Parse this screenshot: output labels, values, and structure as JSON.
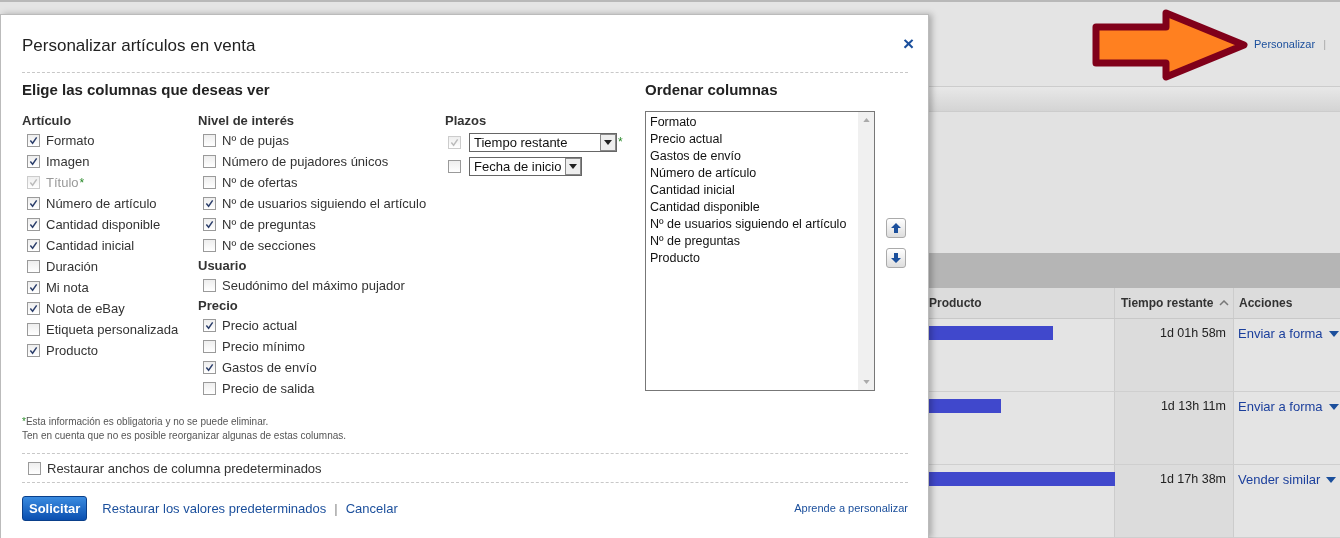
{
  "dialog": {
    "title": "Personalizar artículos en venta",
    "close": "×",
    "section_title": "Elige las columnas que deseas ver",
    "columns": [
      [
        {
          "heading": "Artículo",
          "items": [
            {
              "label": "Formato",
              "checked": true,
              "disabled": false
            },
            {
              "label": "Imagen",
              "checked": true,
              "disabled": false
            },
            {
              "label": "Título",
              "checked": true,
              "disabled": true,
              "note": "*"
            },
            {
              "label": "Número de artículo",
              "checked": true,
              "disabled": false
            },
            {
              "label": "Cantidad disponible",
              "checked": true,
              "disabled": false
            },
            {
              "label": "Cantidad inicial",
              "checked": true,
              "disabled": false
            },
            {
              "label": "Duración",
              "checked": false,
              "disabled": false
            },
            {
              "label": "Mi nota",
              "checked": true,
              "disabled": false
            },
            {
              "label": "Nota de eBay",
              "checked": true,
              "disabled": false
            },
            {
              "label": "Etiqueta personalizada",
              "checked": false,
              "disabled": false
            },
            {
              "label": "Producto",
              "checked": true,
              "disabled": false
            }
          ]
        }
      ],
      [
        {
          "heading": "Nivel de interés",
          "items": [
            {
              "label": "Nº de pujas",
              "checked": false,
              "disabled": false
            },
            {
              "label": "Número de pujadores únicos",
              "checked": false,
              "disabled": false
            },
            {
              "label": "Nº de ofertas",
              "checked": false,
              "disabled": false
            },
            {
              "label": "Nº de usuarios siguiendo el artículo",
              "checked": true,
              "disabled": false
            },
            {
              "label": "Nº de preguntas",
              "checked": true,
              "disabled": false
            },
            {
              "label": "Nº de secciones",
              "checked": false,
              "disabled": false
            }
          ]
        },
        {
          "heading": "Usuario",
          "items": [
            {
              "label": "Seudónimo del máximo pujador",
              "checked": false,
              "disabled": false
            }
          ]
        },
        {
          "heading": "Precio",
          "items": [
            {
              "label": "Precio actual",
              "checked": true,
              "disabled": false
            },
            {
              "label": "Precio mínimo",
              "checked": false,
              "disabled": false
            },
            {
              "label": "Gastos de envío",
              "checked": true,
              "disabled": false
            },
            {
              "label": "Precio de salida",
              "checked": false,
              "disabled": false
            }
          ]
        }
      ]
    ],
    "plazos": {
      "heading": "Plazos",
      "items": [
        {
          "value": "Tiempo restante",
          "checked": true,
          "disabled": true,
          "note": "*"
        },
        {
          "value": "Fecha de inicio",
          "checked": false,
          "disabled": false
        }
      ]
    },
    "order": {
      "heading": "Ordenar columnas",
      "items": [
        "Formato",
        "Precio actual",
        "Gastos de envío",
        "Número de artículo",
        "Cantidad inicial",
        "Cantidad disponible",
        "Nº de usuarios siguiendo el artículo",
        "Nº de preguntas",
        "Producto"
      ]
    },
    "footnotes": [
      {
        "mark": "*",
        "text": "Esta información es obligatoria y no se puede eliminar."
      },
      {
        "text": "Ten en cuenta que no es posible reorganizar algunas de estas columnas."
      }
    ],
    "restore_widths": {
      "label": "Restaurar anchos de columna predeterminados",
      "checked": false
    },
    "submit": "Solicitar",
    "restore_link": "Restaurar los valores predeterminados",
    "separator": "|",
    "cancel": "Cancelar",
    "help_link": "Aprende a personalizar"
  },
  "background": {
    "customize_link": "Personalizar",
    "separator": "|",
    "table": {
      "columns": [
        "Producto",
        "Tiempo restante",
        "Acciones"
      ],
      "rows": [
        {
          "time": "1d 01h 58m",
          "action": "Enviar a forma"
        },
        {
          "time": "1d 13h 11m",
          "action": "Enviar a forma"
        },
        {
          "time": "1d 17h 38m",
          "action": "Vender similar"
        }
      ]
    }
  }
}
